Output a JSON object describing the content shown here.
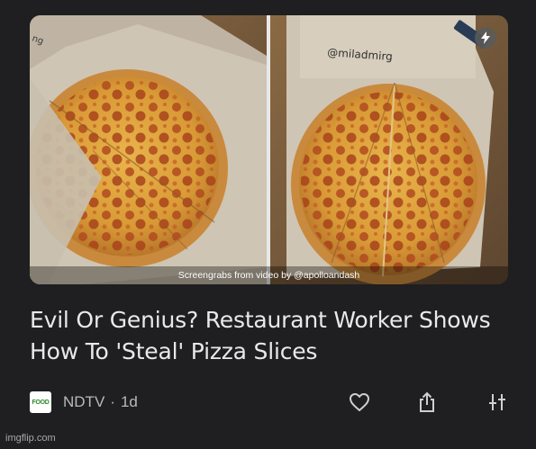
{
  "article": {
    "image_caption": "Screengrabs from video by @apolloandash",
    "box_handwriting": "@miladmirg",
    "headline_line1": "Evil Or Genius? Restaurant Worker Shows",
    "headline_line2": "How To 'Steal' Pizza Slices",
    "source": {
      "logo_text": "FOOD",
      "name": "NDTV",
      "separator": "·",
      "age": "1d"
    },
    "actions": {
      "like_icon": "heart-icon",
      "share_icon": "share-icon",
      "more_icon": "sort-options-icon"
    },
    "badge_icon": "lightning-bolt-icon"
  },
  "watermark": "imgflip.com",
  "colors": {
    "background": "#1f1f21",
    "headline": "#e9e9e9",
    "meta_text": "#b9b9b9",
    "logo_green": "#2b8a2b"
  }
}
